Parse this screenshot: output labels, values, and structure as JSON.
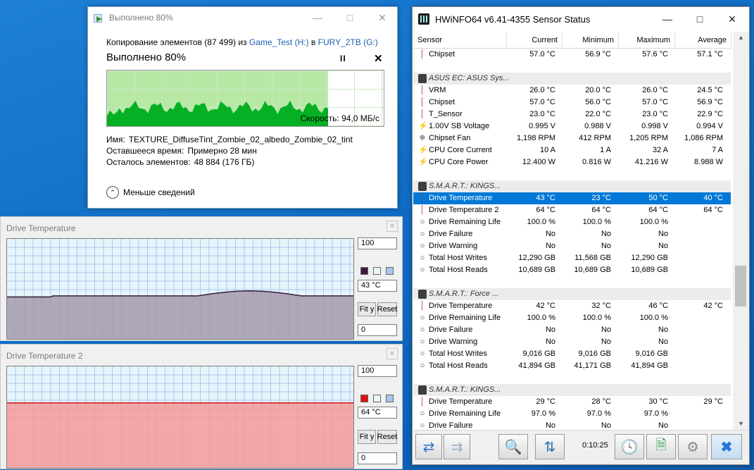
{
  "copy_dialog": {
    "title": "Выполнено 80%",
    "line1": {
      "prefix": "Копирование элементов (87 499) из",
      "source": "Game_Test (H:)",
      "middle": "в",
      "dest": "FURY_2TB (G:)"
    },
    "progress_title": "Выполнено 80%",
    "progress": 0.8,
    "speed": "Скорость: 94,0 МБ/с",
    "name_label": "Имя:",
    "name_value": "TEXTURE_DiffuseTint_Zombie_02_albedo_Zombie_02_tint",
    "time_label": "Оставшееся время:",
    "time_value": "Примерно 28 мин",
    "items_label": "Осталось элементов:",
    "items_value": "48 884 (176 ГБ)",
    "less_details": "Меньше сведений",
    "accent_color": "#06b025"
  },
  "graph1": {
    "title": "Drive Temperature",
    "max": "100",
    "current": "43 °C",
    "min": "0",
    "fit_label": "Fit y",
    "reset_label": "Reset",
    "line_color": "#3a1a3a",
    "fill_color": "#a59aad"
  },
  "graph2": {
    "title": "Drive Temperature 2",
    "max": "100",
    "current": "64 °C",
    "min": "0",
    "fit_label": "Fit y",
    "reset_label": "Reset",
    "line_color": "#cc1111",
    "fill_color": "#f79a9a"
  },
  "hwinfo": {
    "title": "HWiNFO64 v6.41-4355 Sensor Status",
    "columns": [
      "Sensor",
      "Current",
      "Minimum",
      "Maximum",
      "Average"
    ],
    "uptime": "0:10:25",
    "rows": [
      {
        "type": "s",
        "icon": "therm",
        "label": "Chipset",
        "cur": "57.0 °C",
        "min": "56.9 °C",
        "max": "57.6 °C",
        "avg": "57.1 °C"
      },
      {
        "type": "blank"
      },
      {
        "type": "g",
        "label": "ASUS EC: ASUS Sys..."
      },
      {
        "type": "s",
        "icon": "therm",
        "label": "VRM",
        "cur": "26.0 °C",
        "min": "20.0 °C",
        "max": "26.0 °C",
        "avg": "24.5 °C"
      },
      {
        "type": "s",
        "icon": "therm",
        "label": "Chipset",
        "cur": "57.0 °C",
        "min": "56.0 °C",
        "max": "57.0 °C",
        "avg": "56.9 °C"
      },
      {
        "type": "s",
        "icon": "therm",
        "label": "T_Sensor",
        "cur": "23.0 °C",
        "min": "22.0 °C",
        "max": "23.0 °C",
        "avg": "22.9 °C"
      },
      {
        "type": "s",
        "icon": "bolt",
        "label": "1.00V SB Voltage",
        "cur": "0.995 V",
        "min": "0.988 V",
        "max": "0.998 V",
        "avg": "0.994 V"
      },
      {
        "type": "s",
        "icon": "fan",
        "label": "Chipset Fan",
        "cur": "1,198 RPM",
        "min": "412 RPM",
        "max": "1,205 RPM",
        "avg": "1,086 RPM"
      },
      {
        "type": "s",
        "icon": "bolt",
        "label": "CPU Core Current",
        "cur": "10 A",
        "min": "1 A",
        "max": "32 A",
        "avg": "7 A"
      },
      {
        "type": "s",
        "icon": "bolt",
        "label": "CPU Core Power",
        "cur": "12.400 W",
        "min": "0.816 W",
        "max": "41.216 W",
        "avg": "8.988 W"
      },
      {
        "type": "blank"
      },
      {
        "type": "g",
        "label": "S.M.A.R.T.: KINGS..."
      },
      {
        "type": "s",
        "icon": "therm",
        "label": "Drive Temperature",
        "cur": "43 °C",
        "min": "23 °C",
        "max": "50 °C",
        "avg": "40 °C",
        "selected": true
      },
      {
        "type": "s",
        "icon": "therm",
        "label": "Drive Temperature 2",
        "cur": "64 °C",
        "min": "64 °C",
        "max": "64 °C",
        "avg": "64 °C"
      },
      {
        "type": "s",
        "icon": "disk",
        "label": "Drive Remaining Life",
        "cur": "100.0 %",
        "min": "100.0 %",
        "max": "100.0 %",
        "avg": ""
      },
      {
        "type": "s",
        "icon": "disk",
        "label": "Drive Failure",
        "cur": "No",
        "min": "No",
        "max": "No",
        "avg": ""
      },
      {
        "type": "s",
        "icon": "disk",
        "label": "Drive Warning",
        "cur": "No",
        "min": "No",
        "max": "No",
        "avg": ""
      },
      {
        "type": "s",
        "icon": "disk",
        "label": "Total Host Writes",
        "cur": "12,290 GB",
        "min": "11,568 GB",
        "max": "12,290 GB",
        "avg": ""
      },
      {
        "type": "s",
        "icon": "disk",
        "label": "Total Host Reads",
        "cur": "10,689 GB",
        "min": "10,689 GB",
        "max": "10,689 GB",
        "avg": ""
      },
      {
        "type": "blank"
      },
      {
        "type": "g",
        "label": "S.M.A.R.T.: Force ..."
      },
      {
        "type": "s",
        "icon": "therm",
        "label": "Drive Temperature",
        "cur": "42 °C",
        "min": "32 °C",
        "max": "46 °C",
        "avg": "42 °C"
      },
      {
        "type": "s",
        "icon": "disk",
        "label": "Drive Remaining Life",
        "cur": "100.0 %",
        "min": "100.0 %",
        "max": "100.0 %",
        "avg": ""
      },
      {
        "type": "s",
        "icon": "disk",
        "label": "Drive Failure",
        "cur": "No",
        "min": "No",
        "max": "No",
        "avg": ""
      },
      {
        "type": "s",
        "icon": "disk",
        "label": "Drive Warning",
        "cur": "No",
        "min": "No",
        "max": "No",
        "avg": ""
      },
      {
        "type": "s",
        "icon": "disk",
        "label": "Total Host Writes",
        "cur": "9,016 GB",
        "min": "9,016 GB",
        "max": "9,016 GB",
        "avg": ""
      },
      {
        "type": "s",
        "icon": "disk",
        "label": "Total Host Reads",
        "cur": "41,894 GB",
        "min": "41,171 GB",
        "max": "41,894 GB",
        "avg": ""
      },
      {
        "type": "blank"
      },
      {
        "type": "g",
        "label": "S.M.A.R.T.: KINGS..."
      },
      {
        "type": "s",
        "icon": "therm",
        "label": "Drive Temperature",
        "cur": "29 °C",
        "min": "28 °C",
        "max": "30 °C",
        "avg": "29 °C"
      },
      {
        "type": "s",
        "icon": "disk",
        "label": "Drive Remaining Life",
        "cur": "97.0 %",
        "min": "97.0 %",
        "max": "97.0 %",
        "avg": ""
      },
      {
        "type": "s",
        "icon": "disk",
        "label": "Drive Failure",
        "cur": "No",
        "min": "No",
        "max": "No",
        "avg": ""
      }
    ]
  }
}
